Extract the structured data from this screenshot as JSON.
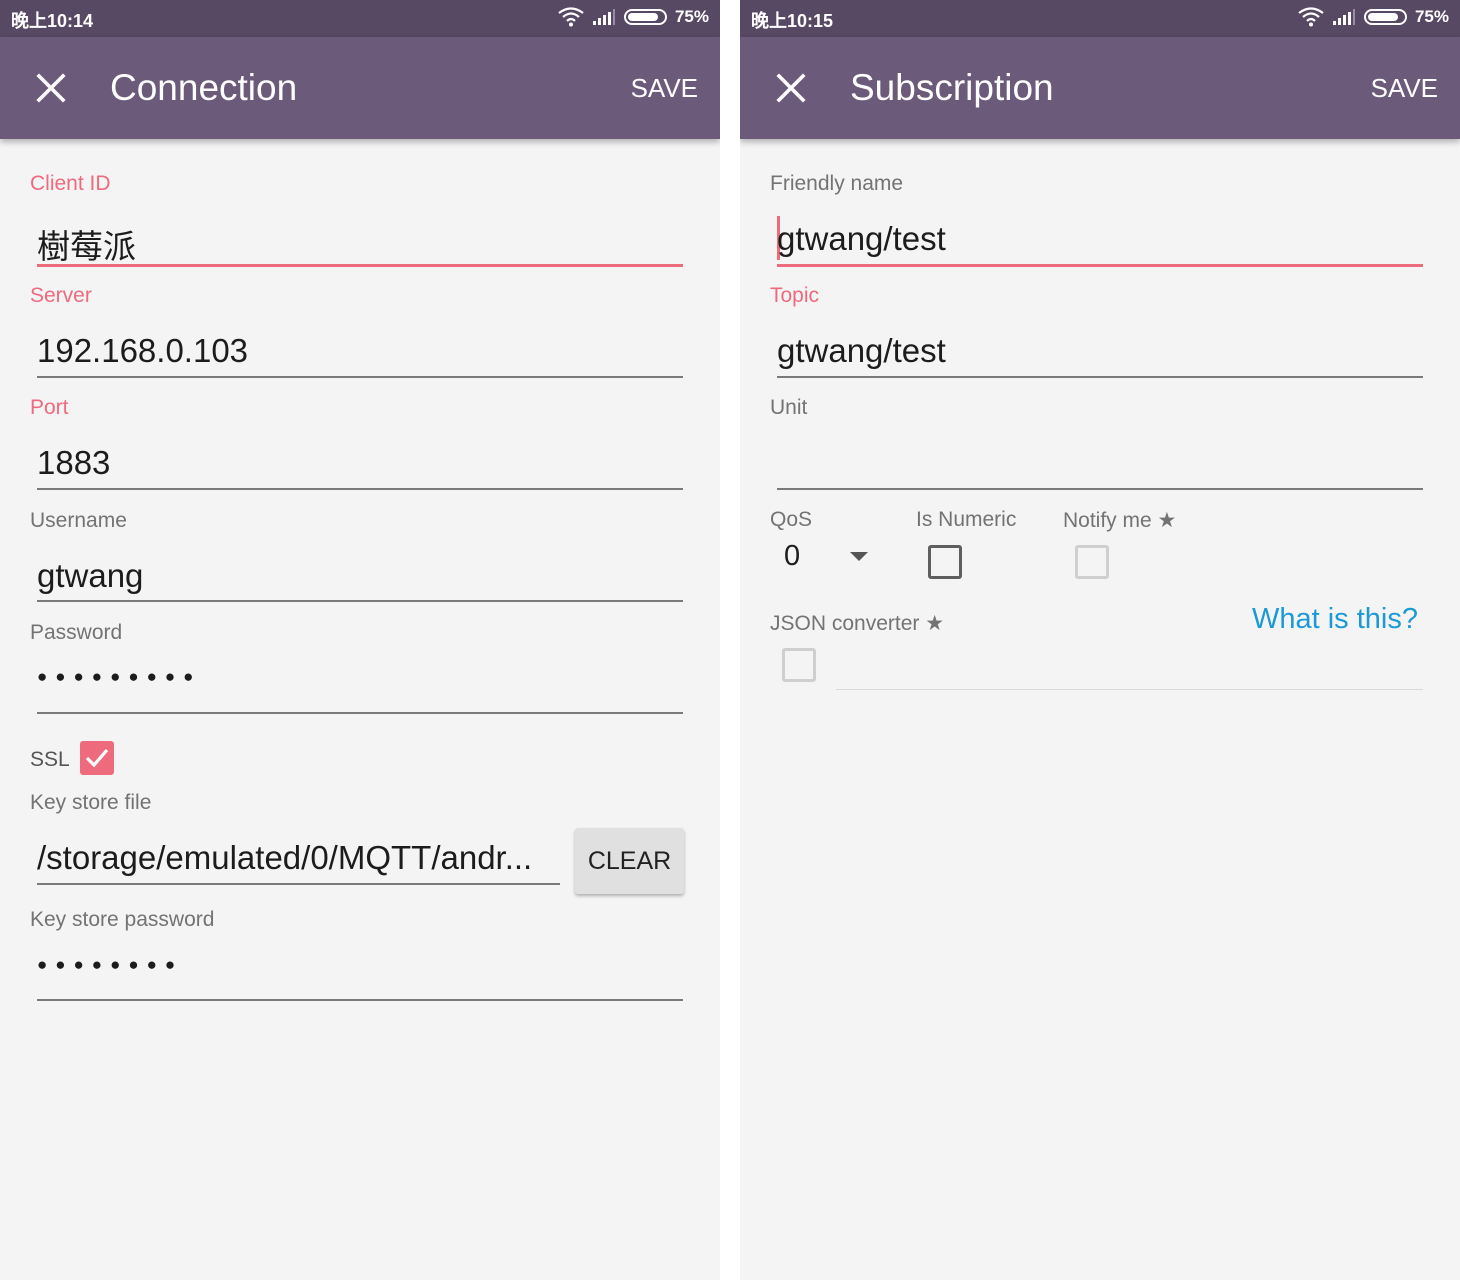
{
  "left": {
    "status": {
      "time": "晚上10:14",
      "battery": "75%"
    },
    "appbar": {
      "title": "Connection",
      "save": "SAVE"
    },
    "client_id": {
      "label": "Client ID",
      "value": "樹莓派"
    },
    "server": {
      "label": "Server",
      "value": "192.168.0.103"
    },
    "port": {
      "label": "Port",
      "value": "1883"
    },
    "username": {
      "label": "Username",
      "value": "gtwang"
    },
    "password": {
      "label": "Password",
      "value": "●●●●●●●●●"
    },
    "ssl": {
      "label": "SSL",
      "checked": true
    },
    "key_store_file": {
      "label": "Key store file",
      "value": "/storage/emulated/0/MQTT/andr...",
      "clear": "CLEAR"
    },
    "key_store_password": {
      "label": "Key store password",
      "value": "●●●●●●●●"
    }
  },
  "right": {
    "status": {
      "time": "晚上10:15",
      "battery": "75%"
    },
    "appbar": {
      "title": "Subscription",
      "save": "SAVE"
    },
    "friendly_name": {
      "label": "Friendly name",
      "value": "gtwang/test"
    },
    "topic": {
      "label": "Topic",
      "value": "gtwang/test"
    },
    "unit": {
      "label": "Unit",
      "value": ""
    },
    "qos": {
      "label": "QoS",
      "value": "0"
    },
    "is_numeric": {
      "label": "Is Numeric",
      "checked": false
    },
    "notify_me": {
      "label": "Notify me ★",
      "checked": false
    },
    "json_converter": {
      "label": "JSON converter ★",
      "checked": false,
      "link": "What is this?"
    }
  },
  "colors": {
    "statusbar": "#574863",
    "appbar": "#6c5a7b",
    "accent": "#ee6b7d",
    "link": "#1c9ad6",
    "background": "#f4f4f4"
  },
  "icons": [
    "wifi-icon",
    "signal-icon",
    "battery-icon",
    "close-icon",
    "check-icon",
    "dropdown-arrow-icon"
  ]
}
